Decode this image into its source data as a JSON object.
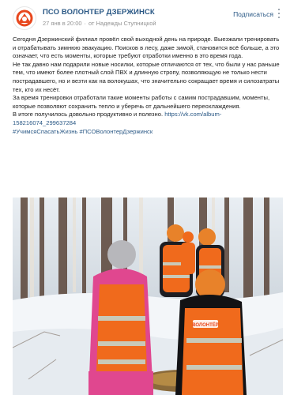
{
  "post": {
    "group_name": "ПСО ВОЛОНТЕР ДЗЕРЖИНСК",
    "date": "27 янв в 20:00",
    "author": "от Надежды Ступницкой",
    "subscribe_label": "Подписаться",
    "paragraphs": [
      "Сегодня Дзержинский филиал провёл свой выходной день на природе. Выезжали тренировать и отрабатывать зимнюю эвакуацию. Поисков в лесу, даже зимой, становится всё больше, а это означает, что есть моменты, которые требуют отработки именно в это время года.",
      "Не так давно нам подарили новые носилки, которые отличаются от тех, что были у нас раньше тем, что имеют более плотный слой ПВХ и длинную стропу, позволяющую не только нести пострадавшего, но и везти как на волокушах, что значительно сокращает время и силозатраты тех, кто их несёт.",
      "За время тренировки отработали такие моменты работы с самим пострадавшим, моменты, которые позволяют сохранить тепло и уберечь от дальнейшего переохлаждения."
    ],
    "closing_text": "В итоге получилось довольно продуктивно и полезно.",
    "link_text": "https://vk.com/album-158216074_299637284",
    "hashtags": "#УчимсяСпасатьЖизнь #ПСОВолонтерДзержинск"
  },
  "photo": {
    "vest_text": "ВОЛОНТЁР"
  },
  "colors": {
    "link": "#2a5885",
    "vest_orange": "#f06a1c",
    "reflective": "#c9c9b8"
  }
}
